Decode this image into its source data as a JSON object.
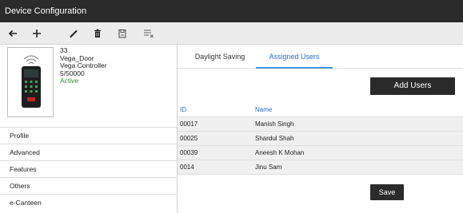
{
  "window": {
    "title": "Device Configuration"
  },
  "toolbar": {
    "buttons": [
      {
        "name": "back-arrow-icon",
        "tooltip": ""
      },
      {
        "name": "plus-icon",
        "tooltip": ""
      },
      {
        "name": "pencil-icon",
        "tooltip": ""
      },
      {
        "name": "trash-icon",
        "tooltip": ""
      },
      {
        "name": "save-disk-icon",
        "tooltip": ""
      },
      {
        "name": "clear-list-icon",
        "tooltip": ""
      }
    ]
  },
  "device": {
    "id": "33",
    "name": "Vega_Door",
    "model": "Vega Controller",
    "users": "5/50000",
    "status": "Active",
    "status_color": "#2e8b2e"
  },
  "nav": {
    "items": [
      {
        "label": "Profile"
      },
      {
        "label": "Advanced"
      },
      {
        "label": "Features"
      },
      {
        "label": "Others"
      },
      {
        "label": "e-Canteen"
      }
    ]
  },
  "tabs": [
    {
      "label": "Daylight Saving",
      "active": false
    },
    {
      "label": "Assigned Users",
      "active": true
    }
  ],
  "assigned_users": {
    "add_button_label": "Add Users",
    "columns": {
      "id": "ID",
      "name": "Name"
    },
    "rows": [
      {
        "id": "00017",
        "name": "Manish Singh"
      },
      {
        "id": "00025",
        "name": "Shardul Shah"
      },
      {
        "id": "00039",
        "name": "Aneesh K Mohan"
      },
      {
        "id": "0014",
        "name": "Jinu Sam"
      }
    ],
    "save_button_label": "Save"
  },
  "colors": {
    "titlebar": "#2b2b2b",
    "accent": "#2b6cc4",
    "button_dark": "#2b2b2b",
    "row_bg": "#f0f0f0"
  }
}
